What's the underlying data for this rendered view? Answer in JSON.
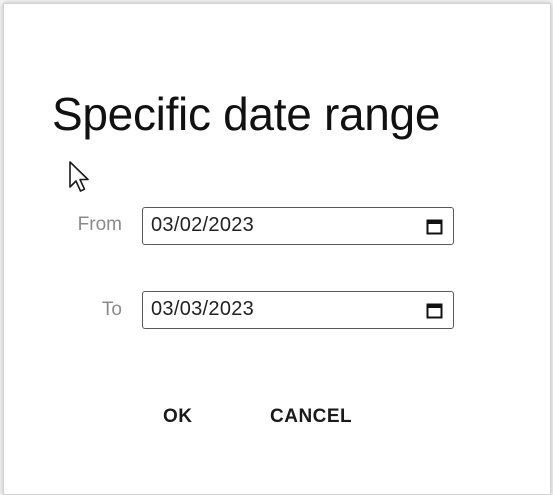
{
  "dialog": {
    "title": "Specific date range",
    "from": {
      "label": "From",
      "value": "03/02/2023"
    },
    "to": {
      "label": "To",
      "value": "03/03/2023"
    },
    "buttons": {
      "ok_label": "OK",
      "cancel_label": "CANCEL"
    },
    "icons": {
      "calendar": "calendar-icon",
      "cursor": "mouse-pointer-icon"
    },
    "colors": {
      "title": "#111111",
      "label": "#8a8a8a",
      "input_border": "#5a5a5a",
      "button_text": "#1a1a1a"
    }
  }
}
